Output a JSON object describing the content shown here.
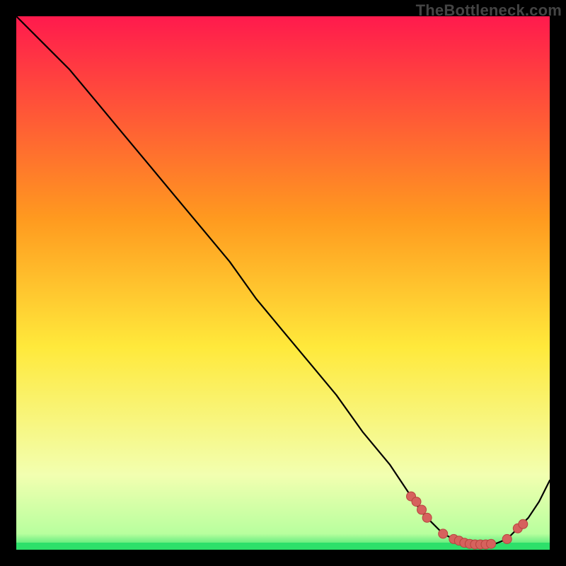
{
  "watermark": "TheBottleneck.com",
  "colors": {
    "bg": "#000000",
    "grad_top": "#ff1a4d",
    "grad_mid1": "#ff9a1f",
    "grad_mid2": "#ffe93b",
    "grad_low": "#f2ffb0",
    "grad_bottom": "#2de06a",
    "curve": "#000000",
    "marker_fill": "#d6625d",
    "marker_stroke": "#b8433e"
  },
  "chart_data": {
    "type": "line",
    "title": "",
    "xlabel": "",
    "ylabel": "",
    "xlim": [
      0,
      100
    ],
    "ylim": [
      0,
      100
    ],
    "series": [
      {
        "name": "curve",
        "x": [
          0,
          6,
          10,
          15,
          20,
          25,
          30,
          35,
          40,
          45,
          50,
          55,
          60,
          65,
          70,
          74,
          76,
          78,
          80,
          82,
          84,
          86,
          88,
          90,
          92,
          94,
          96,
          98,
          100
        ],
        "y": [
          100,
          94,
          90,
          84,
          78,
          72,
          66,
          60,
          54,
          47,
          41,
          35,
          29,
          22,
          16,
          10,
          7,
          5,
          3,
          2,
          1.3,
          1,
          1,
          1.2,
          2,
          4,
          6,
          9,
          13
        ]
      }
    ],
    "markers": {
      "name": "highlighted-points",
      "x": [
        74,
        75,
        76,
        77,
        80,
        82,
        83,
        84,
        85,
        86,
        87,
        88,
        89,
        92,
        94,
        95
      ],
      "y": [
        10,
        9,
        7.5,
        6,
        3,
        2,
        1.7,
        1.3,
        1.1,
        1,
        1,
        1,
        1.1,
        2,
        4,
        4.8
      ]
    }
  }
}
